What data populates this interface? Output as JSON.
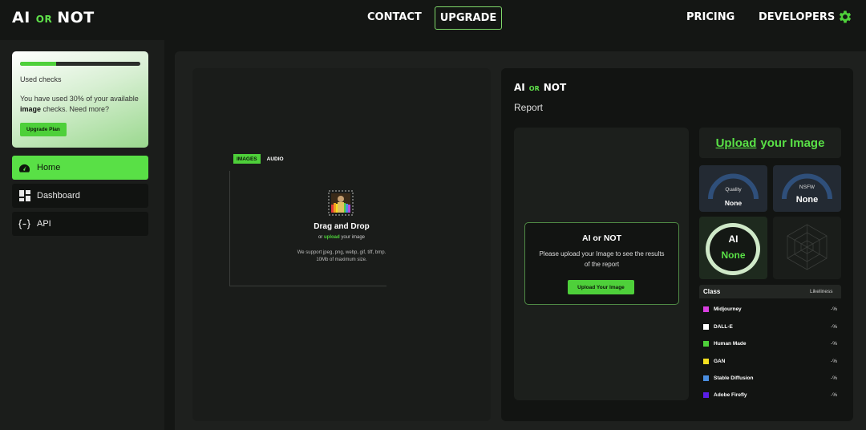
{
  "header": {
    "logo_left": "AI",
    "logo_or": "OR",
    "logo_right": "NOT",
    "nav": {
      "contact": "CONTACT",
      "upgrade": "UPGRADE",
      "pricing": "PRICING",
      "developers": "DEVELOPERS"
    },
    "settings_icon": "gear-icon",
    "accent": "#59e046"
  },
  "sidebar": {
    "usage": {
      "progress": 0.3,
      "label": "Used checks",
      "text_prefix": "You have used 30% of your available ",
      "text_bold": "image",
      "text_suffix": " checks. Need more?",
      "button": "Upgrade Plan"
    },
    "items": [
      {
        "label": "Home",
        "icon": "gauge-icon",
        "active": true
      },
      {
        "label": "Dashboard",
        "icon": "dashboard-icon",
        "active": false
      },
      {
        "label": "API",
        "icon": "api-brackets-icon",
        "active": false
      }
    ]
  },
  "upload_panel": {
    "tabs": [
      "IMAGES",
      "AUDIO"
    ],
    "title": "Drag and Drop",
    "sub_prefix": "or ",
    "sub_link": "upload",
    "sub_suffix": " your image",
    "support": "We support jpeg, png, webp, gif, tiff, bmp. 10Mb of maximum size."
  },
  "report_panel": {
    "logo_left": "AI",
    "logo_or": "OR",
    "logo_right": "NOT",
    "report_label": "Report",
    "cta": {
      "title": "AI or NOT",
      "text": "Please upload your Image to see the results of the report",
      "button": "Upload Your Image"
    },
    "upload_heading_1": "Upload",
    "upload_heading_2": "your Image",
    "quality": {
      "label": "Quality",
      "value": "None"
    },
    "nsfw": {
      "label": "NSFW",
      "value": "None"
    },
    "ai": {
      "label": "AI",
      "value": "None"
    },
    "class_table": {
      "header_class": "Class",
      "header_likeliness": "Likeliness",
      "rows": [
        {
          "name": "Midjourney",
          "value": "-%",
          "color": "#d93fe0"
        },
        {
          "name": "DALL-E",
          "value": "-%",
          "color": "#ffffff"
        },
        {
          "name": "Human Made",
          "value": "-%",
          "color": "#4ed03a"
        },
        {
          "name": "GAN",
          "value": "-%",
          "color": "#f5e020"
        },
        {
          "name": "Stable Diffusion",
          "value": "-%",
          "color": "#4a8ee0"
        },
        {
          "name": "Adobe Firefly",
          "value": "-%",
          "color": "#5a1ee8"
        }
      ]
    }
  }
}
